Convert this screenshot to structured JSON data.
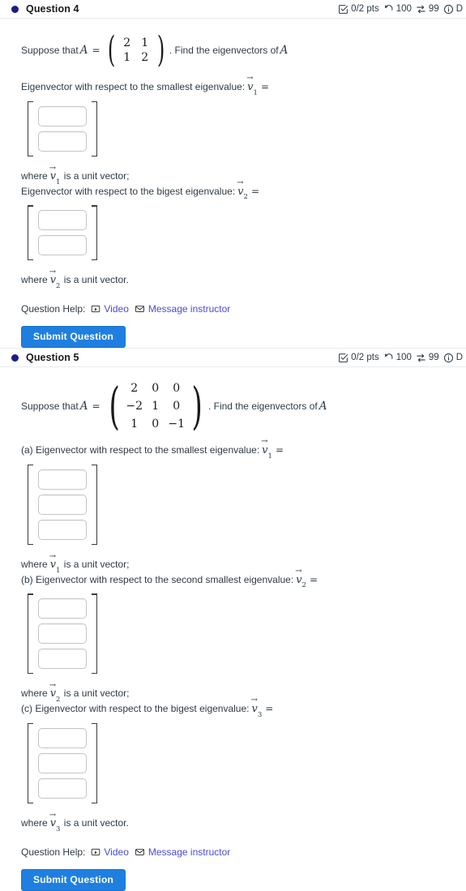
{
  "questions": [
    {
      "id": "q4",
      "bullet_icon": "dot-icon",
      "title": "Question 4",
      "stats": {
        "score_icon": "checkbox-icon",
        "score": "0/2 pts",
        "attempts_icon": "undo-icon",
        "attempts": "100",
        "versions_icon": "shuffle-icon",
        "versions": "99",
        "info_icon": "info-icon",
        "details": "D"
      },
      "statement_prefix": "Suppose that",
      "matrix_var": "A",
      "equals": "=",
      "matrix": [
        [
          "2",
          "1"
        ],
        [
          "1",
          "2"
        ]
      ],
      "statement_suffix": ". Find the eigenvectors of",
      "statement_suffix_var": "A",
      "parts": [
        {
          "prompt": "Eigenvector with respect to the smallest eigenvalue:",
          "vector": "v",
          "vector_sub": "1",
          "vector_eq": "=",
          "inputs": [
            "",
            ""
          ],
          "note_prefix": "where",
          "note_vector": "v",
          "note_vector_sub": "1",
          "note_suffix": "is a unit vector;"
        },
        {
          "prompt": "Eigenvector with respect to the bigest eigenvalue:",
          "vector": "v",
          "vector_sub": "2",
          "vector_eq": "=",
          "inputs": [
            "",
            ""
          ],
          "note_prefix": "where",
          "note_vector": "v",
          "note_vector_sub": "2",
          "note_suffix": "is a unit vector."
        }
      ],
      "help": {
        "label": "Question Help:",
        "video_icon": "video-icon",
        "video_label": "Video",
        "message_icon": "envelope-icon",
        "message_label": "Message instructor"
      },
      "submit_label": "Submit Question"
    },
    {
      "id": "q5",
      "bullet_icon": "dot-icon",
      "title": "Question 5",
      "stats": {
        "score_icon": "checkbox-icon",
        "score": "0/2 pts",
        "attempts_icon": "undo-icon",
        "attempts": "100",
        "versions_icon": "shuffle-icon",
        "versions": "99",
        "info_icon": "info-icon",
        "details": "D"
      },
      "statement_prefix": "Suppose that",
      "matrix_var": "A",
      "equals": "=",
      "matrix": [
        [
          "2",
          "0",
          "0"
        ],
        [
          "−2",
          "1",
          "0"
        ],
        [
          "1",
          "0",
          "−1"
        ]
      ],
      "statement_suffix": ". Find the eigenvectors of",
      "statement_suffix_var": "A",
      "parts": [
        {
          "prompt": "(a) Eigenvector with respect to the smallest eigenvalue:",
          "vector": "v",
          "vector_sub": "1",
          "vector_eq": "=",
          "inputs": [
            "",
            "",
            ""
          ],
          "note_prefix": "where",
          "note_vector": "v",
          "note_vector_sub": "1",
          "note_suffix": "is a unit vector;"
        },
        {
          "prompt": "(b) Eigenvector with respect to the second smallest eigenvalue:",
          "vector": "v",
          "vector_sub": "2",
          "vector_eq": "=",
          "inputs": [
            "",
            "",
            ""
          ],
          "note_prefix": "where",
          "note_vector": "v",
          "note_vector_sub": "2",
          "note_suffix": "is a unit vector;"
        },
        {
          "prompt": "(c) Eigenvector with respect to the bigest eigenvalue:",
          "vector": "v",
          "vector_sub": "3",
          "vector_eq": "=",
          "inputs": [
            "",
            "",
            ""
          ],
          "note_prefix": "where",
          "note_vector": "v",
          "note_vector_sub": "3",
          "note_suffix": "is a unit vector."
        }
      ],
      "help": {
        "label": "Question Help:",
        "video_icon": "video-icon",
        "video_label": "Video",
        "message_icon": "envelope-icon",
        "message_label": "Message instructor"
      },
      "submit_label": "Submit Question"
    }
  ],
  "colors": {
    "bullet": "#1b1b8f",
    "link": "#4a4ad6",
    "submit_bg": "#1f7fe0",
    "separator": "#e8eaec",
    "input_border": "#c3c5c7"
  }
}
